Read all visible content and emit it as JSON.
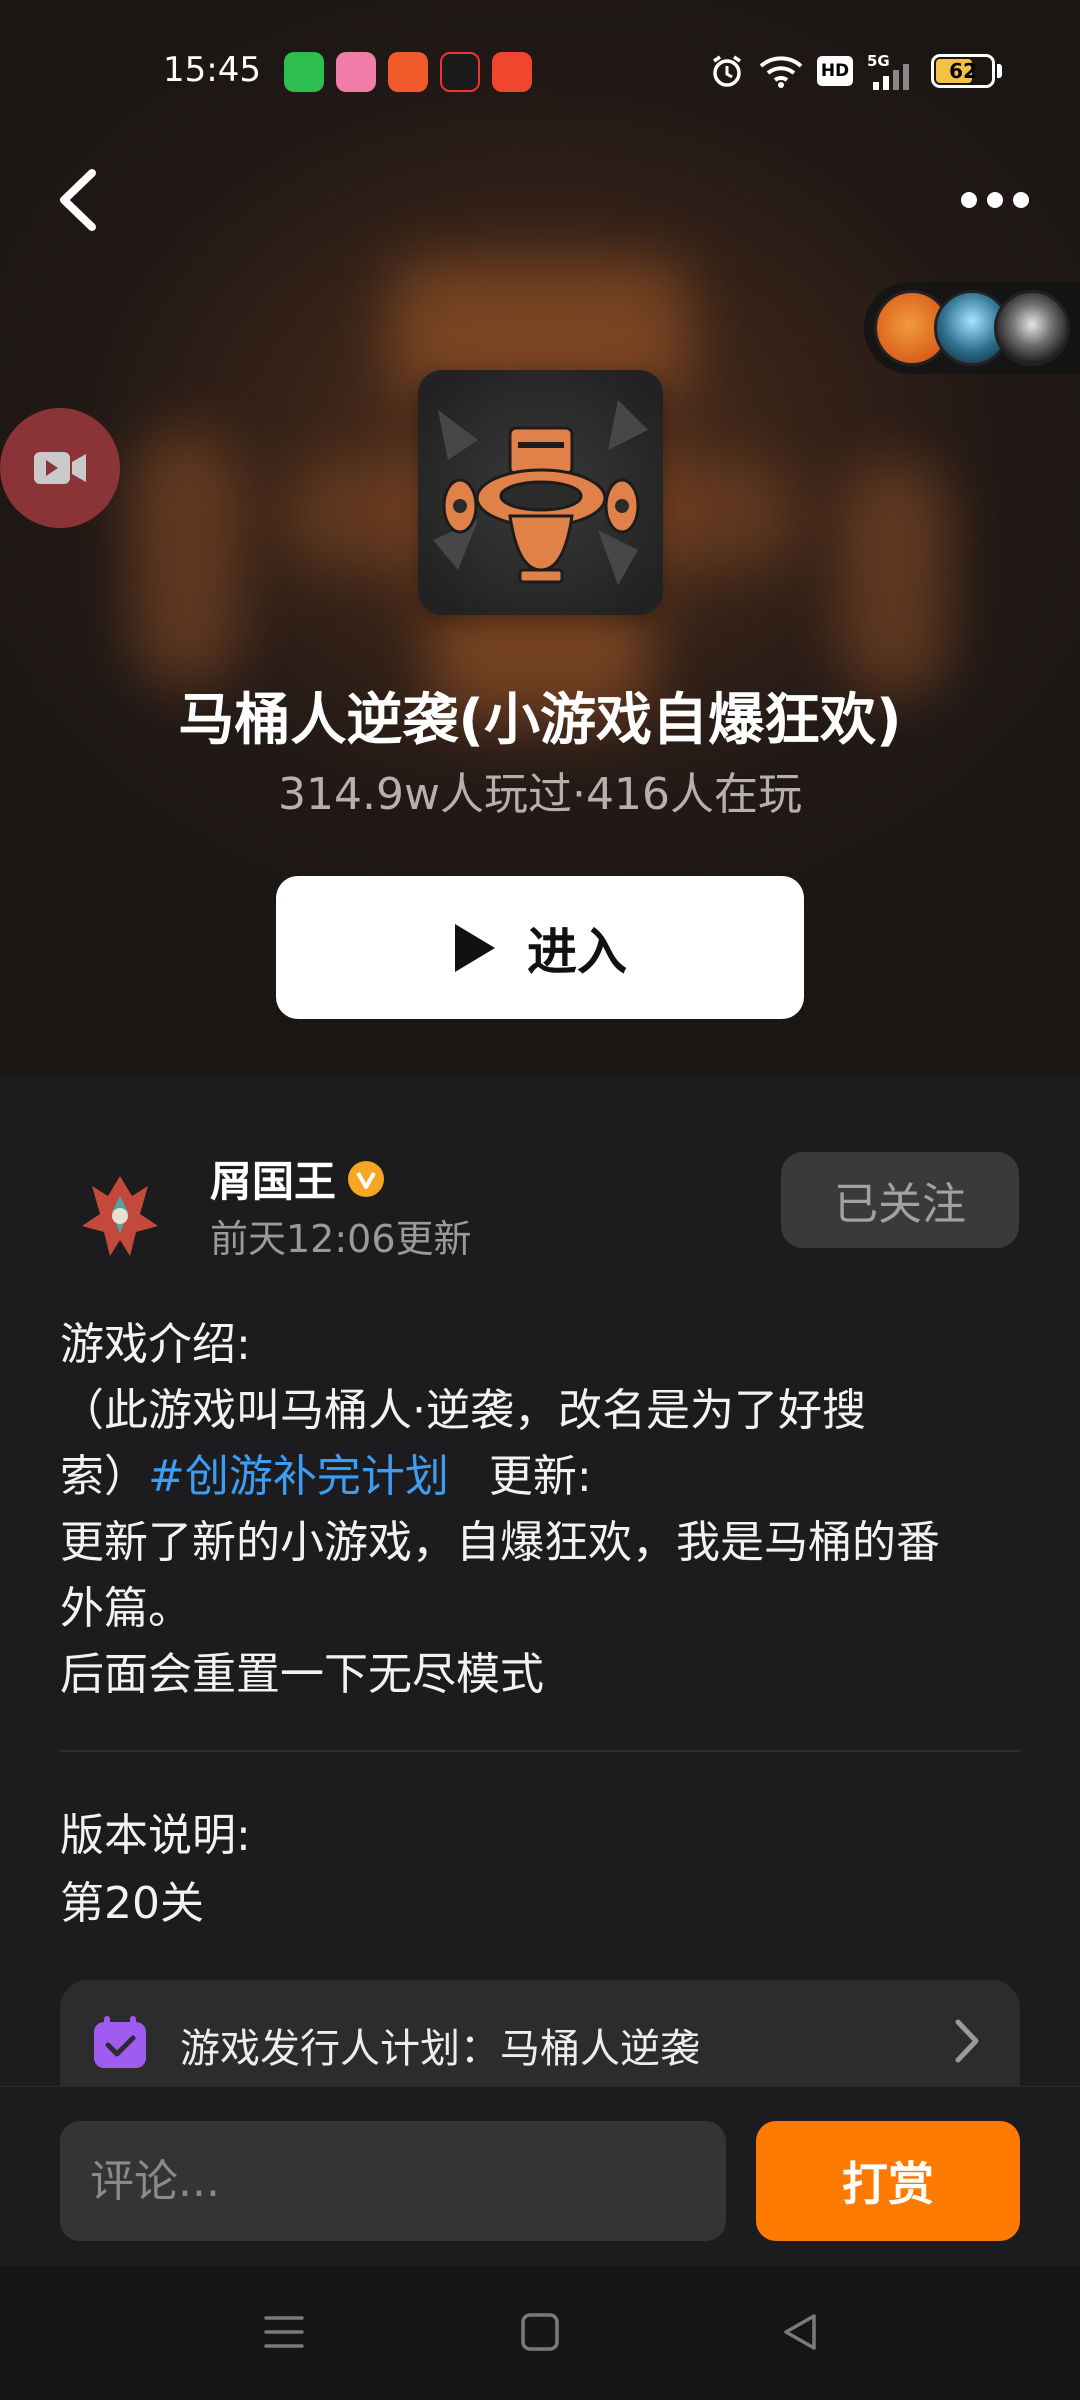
{
  "status_bar": {
    "time": "15:45",
    "battery": "62",
    "network": "5G",
    "hd": "HD"
  },
  "game": {
    "title": "马桶人逆袭(小游戏自爆狂欢)",
    "stats": "314.9w人玩过·416人在玩",
    "enter_label": "进入"
  },
  "author": {
    "name": "屑国王",
    "updated": "前天12:06更新",
    "follow_label": "已关注"
  },
  "description": {
    "line1": "游戏介绍:",
    "line2": "（此游戏叫马桶人·逆袭，改名是为了好搜",
    "line3_prefix": "索）",
    "tag": "#创游补完计划",
    "line3_suffix": "更新:",
    "line4": "更新了新的小游戏，自爆狂欢，我是马桶的番",
    "line5": "外篇。",
    "line6": "后面会重置一下无尽模式"
  },
  "version": {
    "heading": "版本说明:",
    "text": "第20关"
  },
  "plan_card": {
    "text": "游戏发行人计划：马桶人逆袭"
  },
  "bottom": {
    "comment_placeholder": "评论...",
    "tip_label": "打赏"
  },
  "colors": {
    "accent_orange": "#ff7a00",
    "tag_blue": "#3d9df5",
    "plan_purple": "#a05cf0",
    "verified_gold": "#f5a623"
  }
}
